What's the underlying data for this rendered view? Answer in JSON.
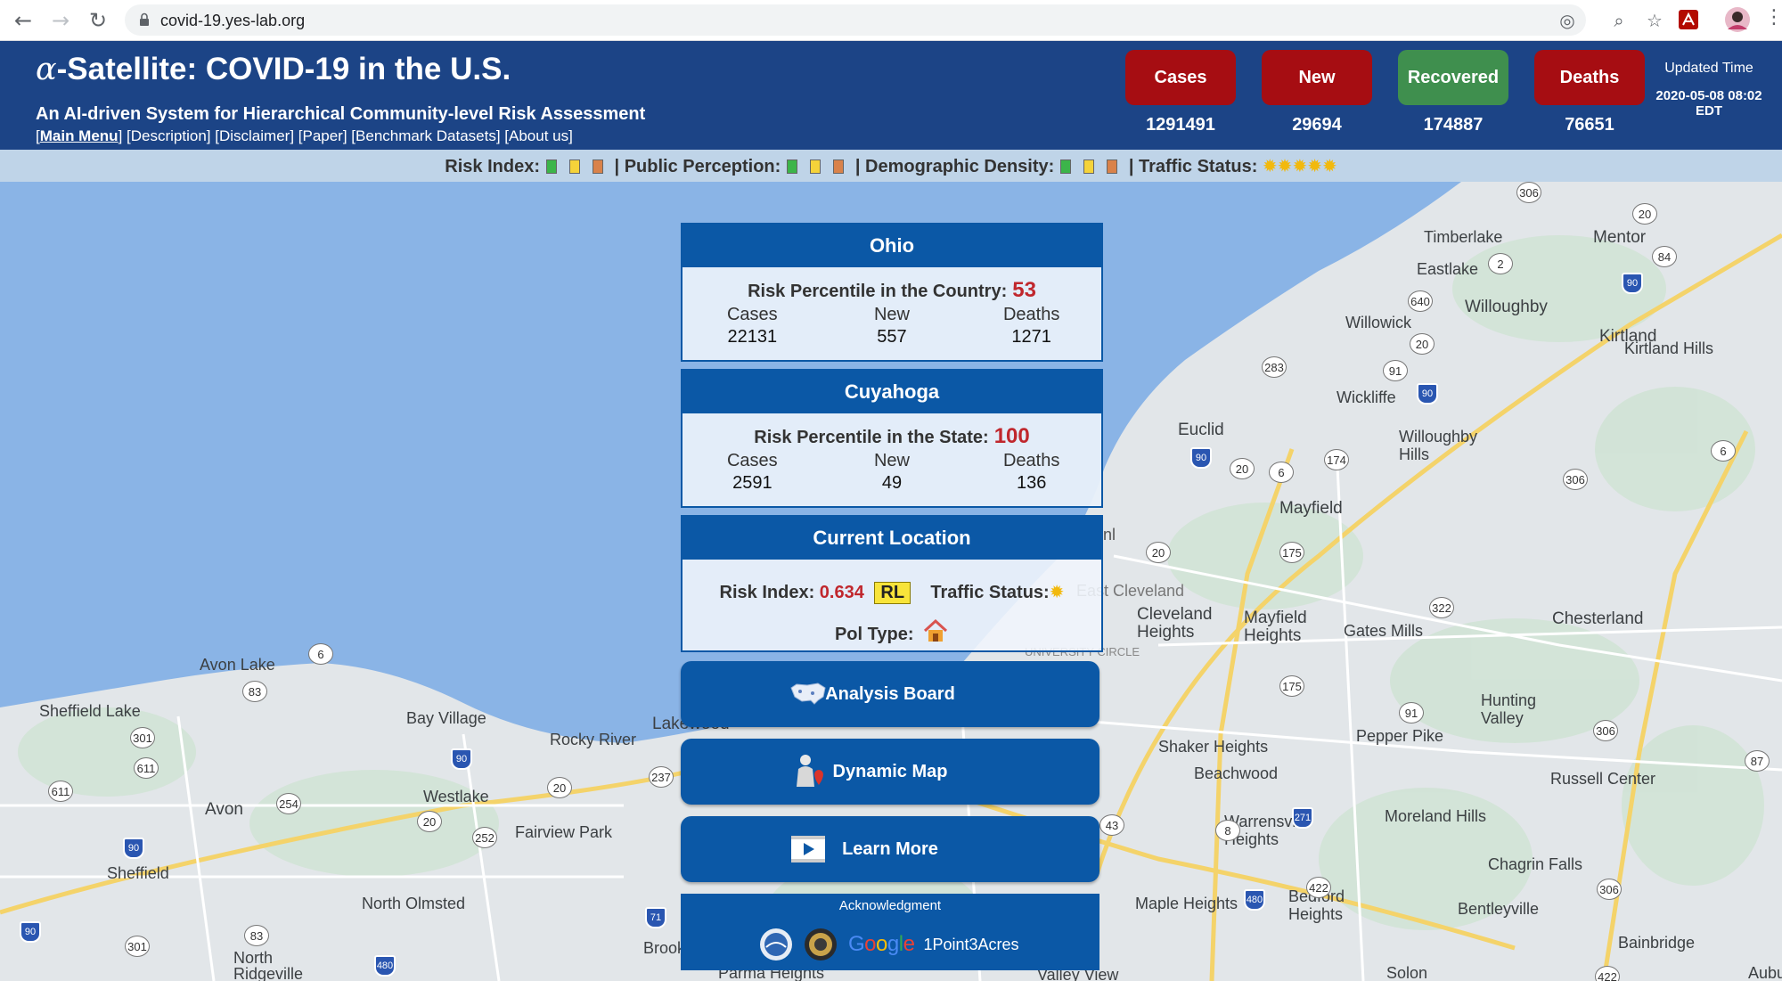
{
  "browser": {
    "url": "covid-19.yes-lab.org"
  },
  "header": {
    "title_alpha": "α",
    "title_rest": "-Satellite: COVID-19 in the U.S.",
    "subtitle": "An AI-driven System for Hierarchical Community-level Risk Assessment",
    "links": [
      "Main Menu",
      "Description",
      "Disclaimer",
      "Paper",
      "Benchmark Datasets",
      "About us"
    ],
    "stats": [
      {
        "label": "Cases",
        "value": "1291491",
        "color": "#a60d12"
      },
      {
        "label": "New",
        "value": "29694",
        "color": "#a60d12"
      },
      {
        "label": "Recovered",
        "value": "174887",
        "color": "#3f8f4e"
      },
      {
        "label": "Deaths",
        "value": "76651",
        "color": "#a60d12"
      }
    ],
    "updated_label": "Updated Time",
    "updated_time_line1": "2020-05-08 08:02",
    "updated_time_line2": "EDT"
  },
  "legend": {
    "risk_index": "Risk Index:",
    "public_perception": "| Public Perception:",
    "demographic_density": "| Demographic Density:",
    "traffic_status": "| Traffic Status:",
    "colors": {
      "low": "#3cb54a",
      "mid": "#f5d33a",
      "high": "#d9824a"
    }
  },
  "state_card": {
    "name": "Ohio",
    "risk_label": "Risk Percentile in the Country:",
    "risk_value": "53",
    "cases_label": "Cases",
    "new_label": "New",
    "deaths_label": "Deaths",
    "cases": "22131",
    "new": "557",
    "deaths": "1271"
  },
  "county_card": {
    "name": "Cuyahoga",
    "risk_label": "Risk Percentile in the State:",
    "risk_value": "100",
    "cases_label": "Cases",
    "new_label": "New",
    "deaths_label": "Deaths",
    "cases": "2591",
    "new": "49",
    "deaths": "136"
  },
  "location_card": {
    "title": "Current Location",
    "risk_index_label": "Risk Index:",
    "risk_index_value": "0.634",
    "risk_badge": "RL",
    "traffic_label": "Traffic Status:",
    "pol_type_label": "Pol Type:"
  },
  "buttons": {
    "analysis": "Analysis Board",
    "dynamic_map": "Dynamic Map",
    "learn_more": "Learn More"
  },
  "acknowledgment": {
    "title": "Acknowledgment",
    "google": "Google",
    "partner": "1Point3Acres"
  },
  "map": {
    "places": [
      "Timberlake",
      "Mentor",
      "Eastlake",
      "Willoughby",
      "Kirtland",
      "Willowick",
      "Kirtland Hills",
      "Wickliffe",
      "Euclid",
      "Willoughby Hills",
      "Mayfield",
      "East Cleveland",
      "Cleveland Heights",
      "Mayfield Heights",
      "Gates Mills",
      "Chesterland",
      "Avon Lake",
      "Sheffield Lake",
      "Bay Village",
      "Lakewood",
      "Rocky River",
      "Westlake",
      "Avon",
      "Fairview Park",
      "Sheffield",
      "North Olmsted",
      "North Ridgeville",
      "Brook",
      "Parma Heights",
      "Shaker Heights",
      "Beachwood",
      "Pepper Pike",
      "Hunting Valley",
      "Russell Center",
      "Moreland Hills",
      "Warrensville Heights",
      "Chagrin Falls",
      "Maple Heights",
      "Bedford Heights",
      "Bentleyville",
      "Bainbridge",
      "Solon",
      "Valley View",
      "Aubu",
      "UNIVERSITY CIRCLE",
      "nl"
    ]
  }
}
